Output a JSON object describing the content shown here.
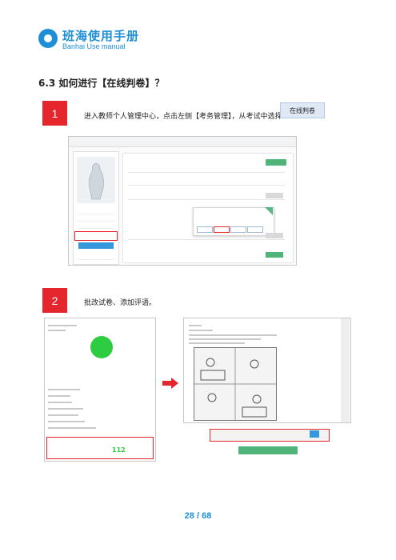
{
  "header": {
    "brand": "班海使用手册",
    "subtitle": "Banhai Use manual"
  },
  "section": {
    "title": "6.3 如何进行【在线判卷】？"
  },
  "steps": [
    {
      "number": "1",
      "text": "进入教师个人管理中心，点击左侧【考务管理】，从考试中选择",
      "chip": "在线判卷"
    },
    {
      "number": "2",
      "text": "批改试卷、添加评语。"
    }
  ],
  "screenshot2": {
    "score": "112"
  },
  "footer": {
    "page": "28 / 68"
  },
  "colors": {
    "brand": "#1e8fd6",
    "badge": "#e5262d",
    "accent_green": "#4fb37a"
  },
  "icons": {
    "logo": "banhai-logo-icon",
    "arrow": "arrow-right-icon"
  }
}
